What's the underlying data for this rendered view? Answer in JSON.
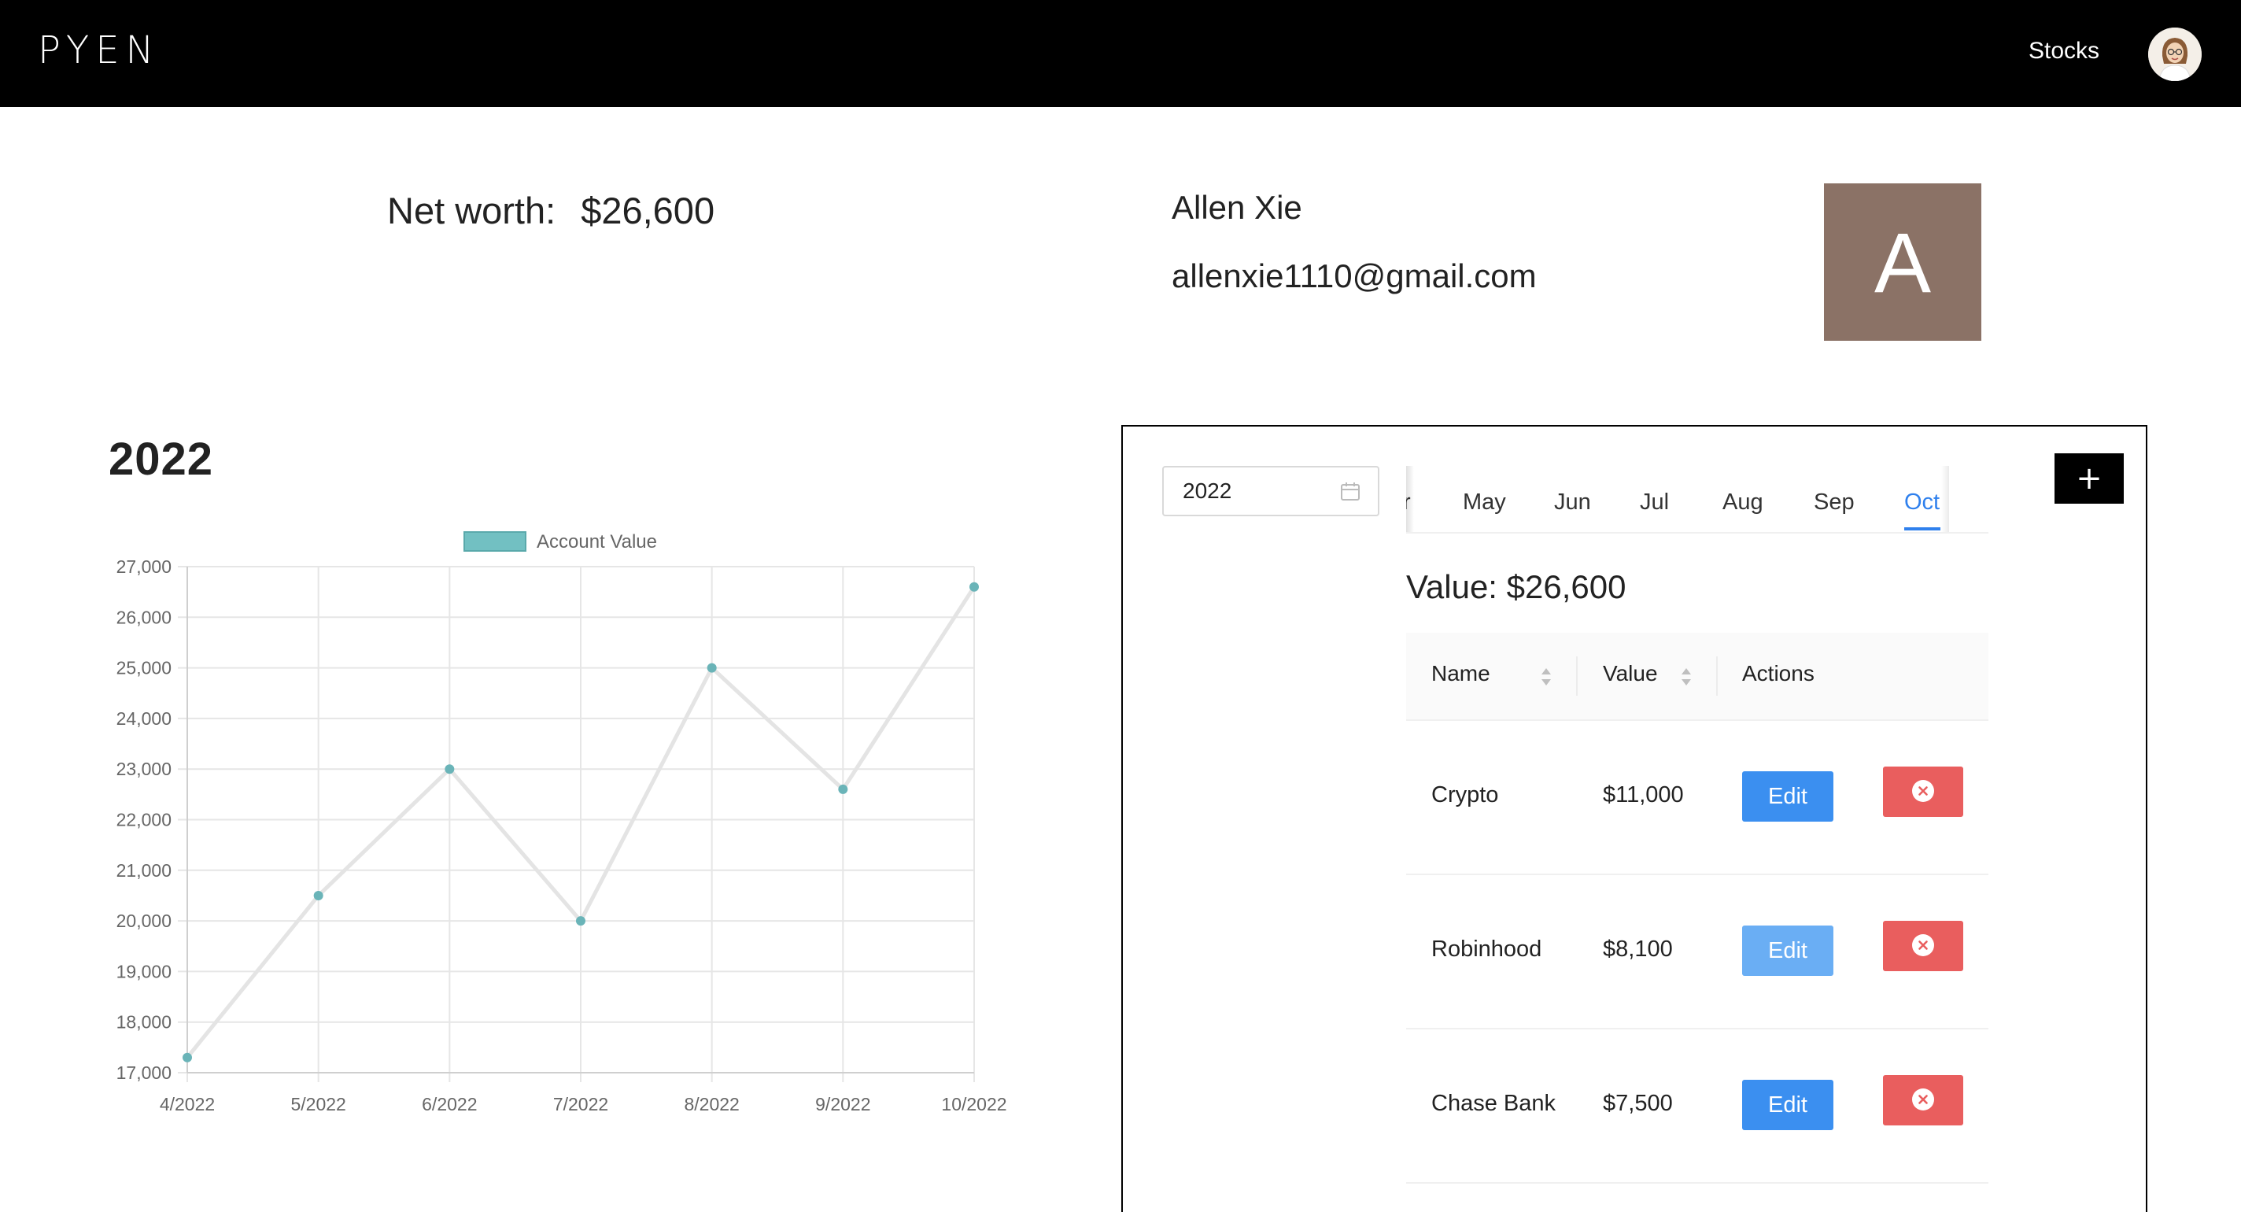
{
  "navbar": {
    "brand": "PYEN",
    "link_stocks": "Stocks",
    "avatar_icon": "user-avatar-icon"
  },
  "profile": {
    "networth_label": "Net worth:",
    "networth_value": "$26,600",
    "name": "Allen Xie",
    "email": "allenxie1110@gmail.com",
    "avatar_initial": "A",
    "avatar_color": "#8b7266"
  },
  "chart_title": "2022",
  "chart_data": {
    "type": "line",
    "categories": [
      "4/2022",
      "5/2022",
      "6/2022",
      "7/2022",
      "8/2022",
      "9/2022",
      "10/2022"
    ],
    "series": [
      {
        "name": "Account Value",
        "values": [
          17300,
          20500,
          23000,
          20000,
          25000,
          22600,
          26600
        ]
      }
    ],
    "ylim": [
      17000,
      27000
    ],
    "yticks": [
      "27,000",
      "26,000",
      "25,000",
      "24,000",
      "23,000",
      "22,000",
      "21,000",
      "20,000",
      "19,000",
      "18,000",
      "17,000"
    ],
    "grid": true,
    "legend_position": "top",
    "line_color": "#e4e4e4",
    "point_color": "#6ab4b8",
    "legend_color": "#72c0c2"
  },
  "panel": {
    "year": "2022",
    "calendar_icon": "calendar-icon",
    "tabs": [
      {
        "label": "r",
        "active": false
      },
      {
        "label": "May",
        "active": false
      },
      {
        "label": "Jun",
        "active": false
      },
      {
        "label": "Jul",
        "active": false
      },
      {
        "label": "Aug",
        "active": false
      },
      {
        "label": "Sep",
        "active": false
      },
      {
        "label": "Oct",
        "active": true
      }
    ],
    "add_label": "+",
    "value_heading": "Value: $26,600",
    "table": {
      "columns": [
        "Name",
        "Value",
        "Actions"
      ],
      "rows": [
        {
          "name": "Crypto",
          "value": "$11,000",
          "edit": "Edit"
        },
        {
          "name": "Robinhood",
          "value": "$8,100",
          "edit": "Edit"
        },
        {
          "name": "Chase Bank",
          "value": "$7,500",
          "edit": "Edit"
        }
      ]
    },
    "accent_color": "#2f80ed",
    "delete_color": "#e95e5e"
  }
}
